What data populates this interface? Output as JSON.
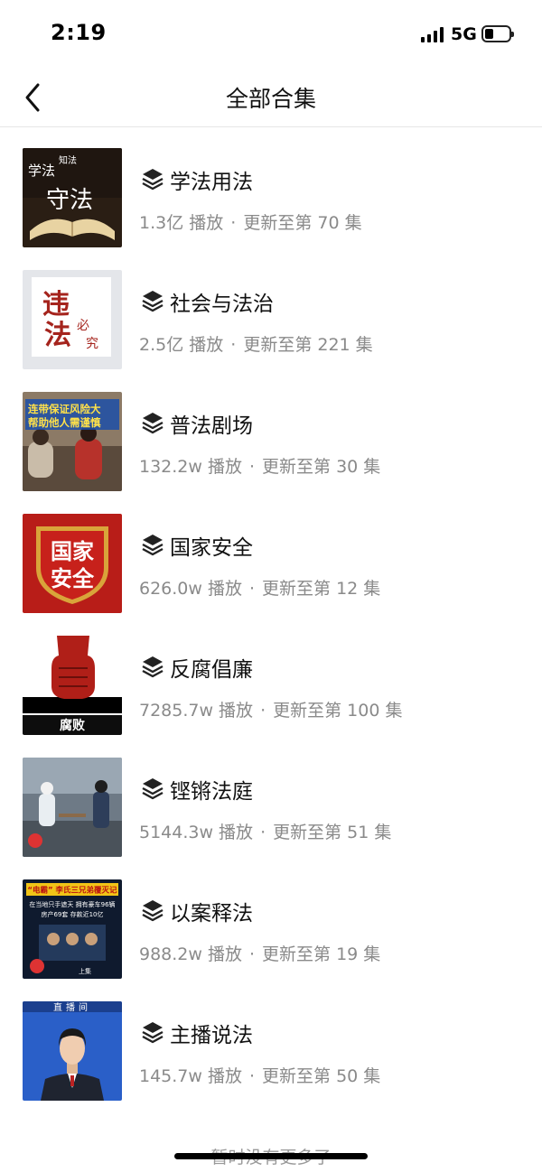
{
  "status_bar": {
    "time": "2:19",
    "network": "5G",
    "battery_level": 0.35
  },
  "nav": {
    "title": "全部合集",
    "back_icon": "chevron-left-icon"
  },
  "collections": [
    {
      "title": "学法用法",
      "plays": "1.3亿 播放",
      "update": "更新至第 70 集",
      "thumb_icon": "book-thumbnail",
      "thumb_text": [
        "学法",
        "知法",
        "守法"
      ]
    },
    {
      "title": "社会与法治",
      "plays": "2.5亿 播放",
      "update": "更新至第 221 集",
      "thumb_icon": "calligraphy-thumbnail",
      "thumb_text": [
        "违",
        "法",
        "必",
        "究"
      ]
    },
    {
      "title": "普法剧场",
      "plays": "132.2w 播放",
      "update": "更新至第 30 集",
      "thumb_icon": "drama-thumbnail",
      "thumb_text": [
        "连带保证风险大",
        "帮助他人需谨慎"
      ]
    },
    {
      "title": "国家安全",
      "plays": "626.0w 播放",
      "update": "更新至第 12 集",
      "thumb_icon": "shield-thumbnail",
      "thumb_text": [
        "国家",
        "安全"
      ]
    },
    {
      "title": "反腐倡廉",
      "plays": "7285.7w 播放",
      "update": "更新至第 100 集",
      "thumb_icon": "fist-thumbnail",
      "thumb_text": [
        "腐败"
      ]
    },
    {
      "title": "铿锵法庭",
      "plays": "5144.3w 播放",
      "update": "更新至第 51 集",
      "thumb_icon": "courtroom-thumbnail",
      "thumb_text": []
    },
    {
      "title": "以案释法",
      "plays": "988.2w 播放",
      "update": "更新至第 19 集",
      "thumb_icon": "case-thumbnail",
      "thumb_text": [
        "“电霸” 李氏三兄弟覆灭记",
        "在当地只手遮天 拥有豪车96辆",
        "房产69套 存款近10亿",
        "上集"
      ]
    },
    {
      "title": "主播说法",
      "plays": "145.7w 播放",
      "update": "更新至第 50 集",
      "thumb_icon": "anchor-thumbnail",
      "thumb_text": [
        "直播间"
      ]
    }
  ],
  "footer": {
    "text": "暂时没有更多了"
  },
  "colors": {
    "meta_text": "#8a8a8a",
    "divider": "#e6e6e6"
  }
}
